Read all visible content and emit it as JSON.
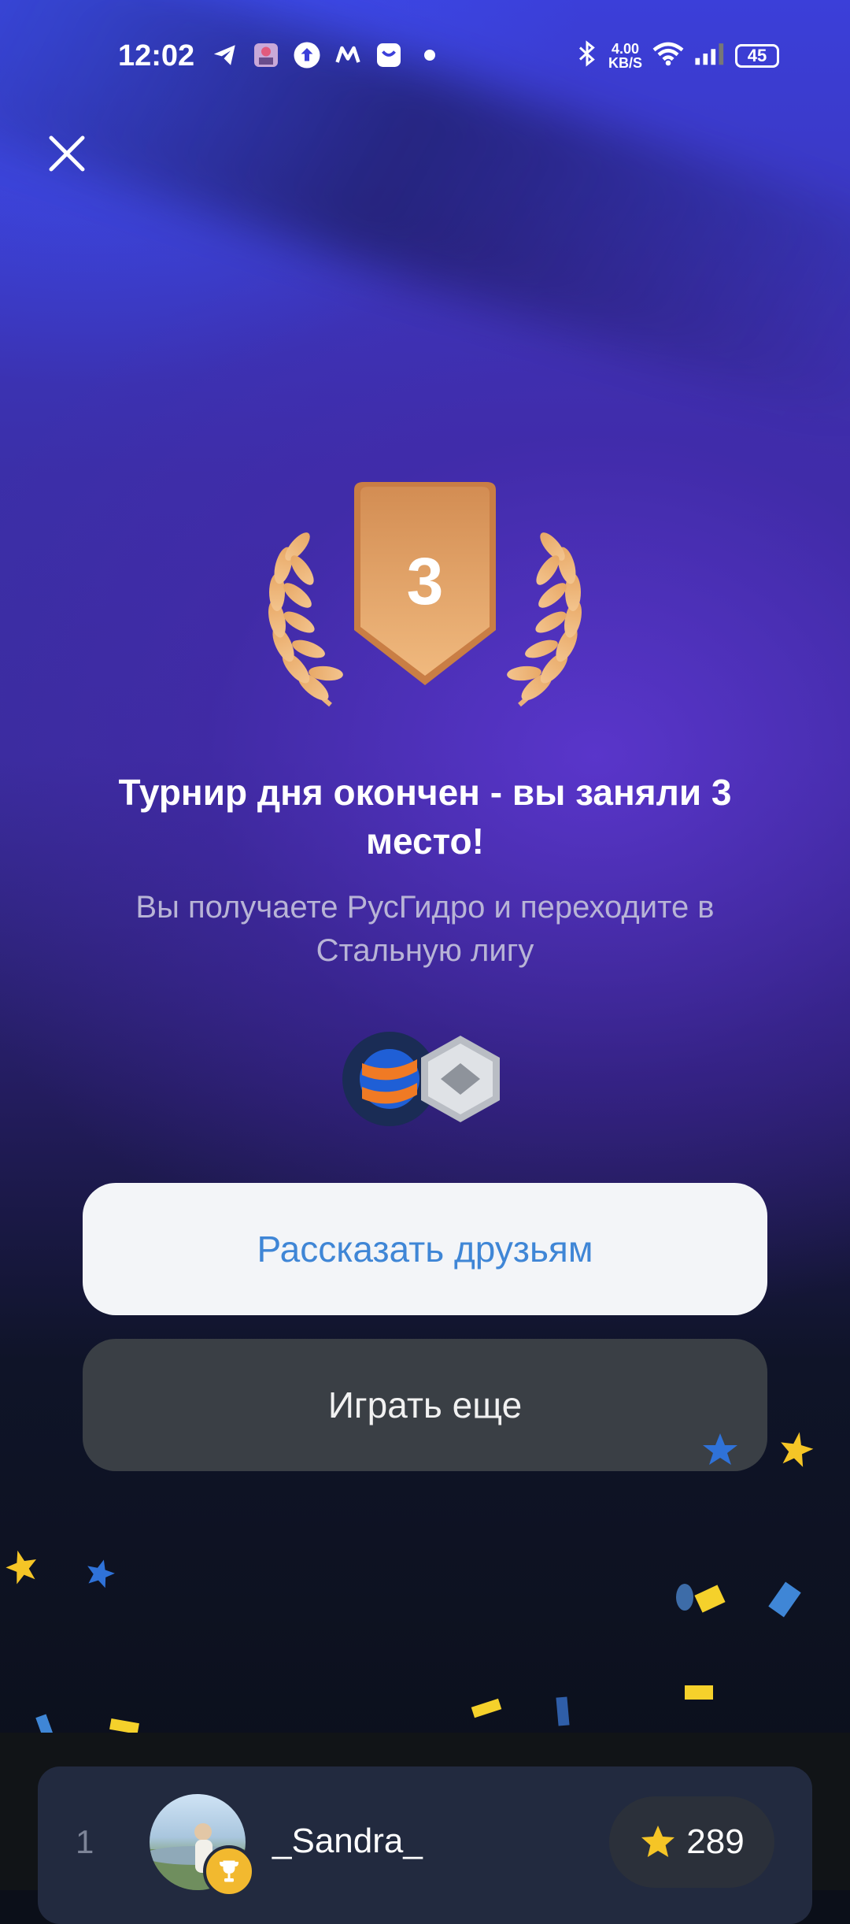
{
  "status_bar": {
    "time": "12:02",
    "net_speed_value": "4.00",
    "net_speed_unit": "KB/S",
    "battery": "45"
  },
  "result": {
    "place": "3",
    "title": "Турнир дня окончен - вы заняли 3 место!",
    "subtitle": "Вы получаете РусГидро и переходите в Стальную лигу"
  },
  "buttons": {
    "share_label": "Рассказать друзьям",
    "play_label": "Играть еще"
  },
  "leaderboard": {
    "rows": [
      {
        "rank": "1",
        "username": "_Sandra_",
        "score": "289"
      }
    ]
  },
  "colors": {
    "accent_blue": "#3f86d6",
    "bronze": "#d9955a",
    "star_yellow": "#f5c526"
  }
}
